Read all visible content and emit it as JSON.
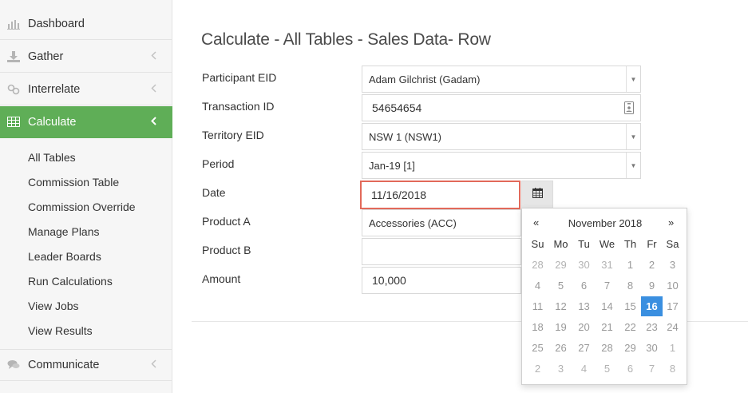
{
  "sidebar": {
    "items": [
      {
        "label": "Dashboard",
        "icon": "bar-chart-icon"
      },
      {
        "label": "Gather",
        "icon": "download-icon"
      },
      {
        "label": "Interrelate",
        "icon": "link-icon"
      },
      {
        "label": "Calculate",
        "icon": "table-icon"
      },
      {
        "label": "Communicate",
        "icon": "comments-icon"
      }
    ],
    "calculate_subitems": [
      "All Tables",
      "Commission Table",
      "Commission Override",
      "Manage Plans",
      "Leader Boards",
      "Run Calculations",
      "View Jobs",
      "View Results"
    ],
    "active_color": "#5fae57"
  },
  "main": {
    "title": "Calculate - All Tables - Sales Data- Row",
    "form": {
      "participant_eid": {
        "label": "Participant EID",
        "value": "Adam Gilchrist (Gadam)"
      },
      "transaction_id": {
        "label": "Transaction ID",
        "value": "54654654"
      },
      "territory_eid": {
        "label": "Territory EID",
        "value": "NSW 1 (NSW1)"
      },
      "period": {
        "label": "Period",
        "value": "Jan-19 [1]"
      },
      "date": {
        "label": "Date",
        "value": "11/16/2018"
      },
      "product_a": {
        "label": "Product A",
        "value": "Accessories (ACC)"
      },
      "product_b": {
        "label": "Product B",
        "value": ""
      },
      "amount": {
        "label": "Amount",
        "value": "10,000"
      }
    }
  },
  "datepicker": {
    "prev": "«",
    "next": "»",
    "month_label": "November 2018",
    "weekdays": [
      "Su",
      "Mo",
      "Tu",
      "We",
      "Th",
      "Fr",
      "Sa"
    ],
    "weeks": [
      [
        "28",
        "29",
        "30",
        "31",
        "1",
        "2",
        "3"
      ],
      [
        "4",
        "5",
        "6",
        "7",
        "8",
        "9",
        "10"
      ],
      [
        "11",
        "12",
        "13",
        "14",
        "15",
        "16",
        "17"
      ],
      [
        "18",
        "19",
        "20",
        "21",
        "22",
        "23",
        "24"
      ],
      [
        "25",
        "26",
        "27",
        "28",
        "29",
        "30",
        "1"
      ],
      [
        "2",
        "3",
        "4",
        "5",
        "6",
        "7",
        "8"
      ]
    ],
    "selected_day": "16",
    "selected_color": "#3a8fe0"
  },
  "accent_error_border": "#e2695a"
}
